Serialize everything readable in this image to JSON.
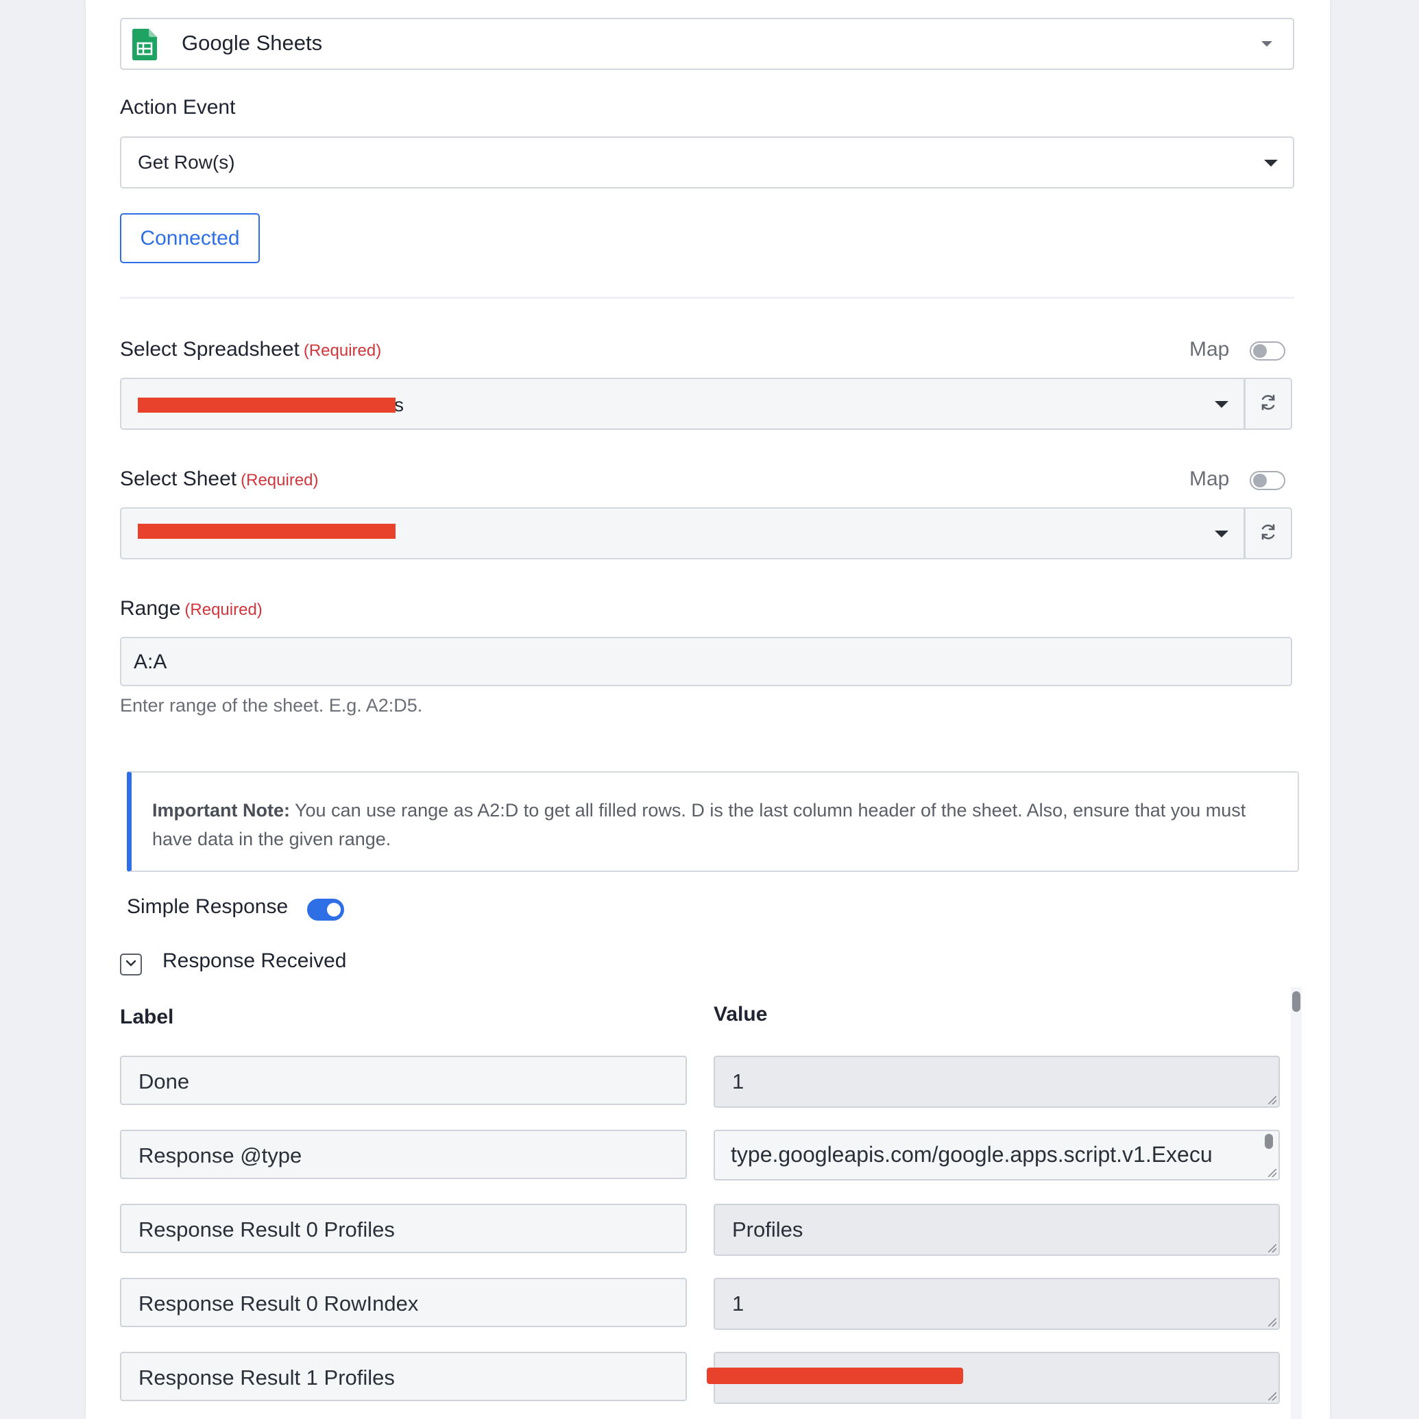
{
  "app": {
    "selected": "Google Sheets",
    "icon": "google-sheets-icon"
  },
  "action_event": {
    "label": "Action Event",
    "selected": "Get Row(s)"
  },
  "connection": {
    "button_label": "Connected"
  },
  "spreadsheet": {
    "label": "Select Spreadsheet",
    "required": "(Required)",
    "map_label": "Map",
    "value_visible": "s"
  },
  "sheet": {
    "label": "Select Sheet",
    "required": "(Required)",
    "map_label": "Map"
  },
  "range": {
    "label": "Range",
    "required": "(Required)",
    "value": "A:A",
    "help": "Enter range of the sheet. E.g. A2:D5."
  },
  "note": {
    "title": "Important Note:",
    "text": " You can use range as A2:D to get all filled rows. D is the last column header of the sheet. Also, ensure that you must have data in the given range."
  },
  "simple_response": {
    "label": "Simple Response",
    "enabled": true
  },
  "response": {
    "label": "Response Received",
    "columns": {
      "label": "Label",
      "value": "Value"
    },
    "rows": [
      {
        "label": "Done",
        "value": "1"
      },
      {
        "label": "Response @type",
        "value": "type.googleapis.com/google.apps.script.v1.Execu"
      },
      {
        "label": "Response Result 0 Profiles",
        "value": "Profiles"
      },
      {
        "label": "Response Result 0 RowIndex",
        "value": "1"
      },
      {
        "label": "Response Result 1 Profiles",
        "value": ""
      }
    ]
  },
  "colors": {
    "accent": "#2e6fe6",
    "required": "#d0363b",
    "redaction": "#e8412c"
  }
}
